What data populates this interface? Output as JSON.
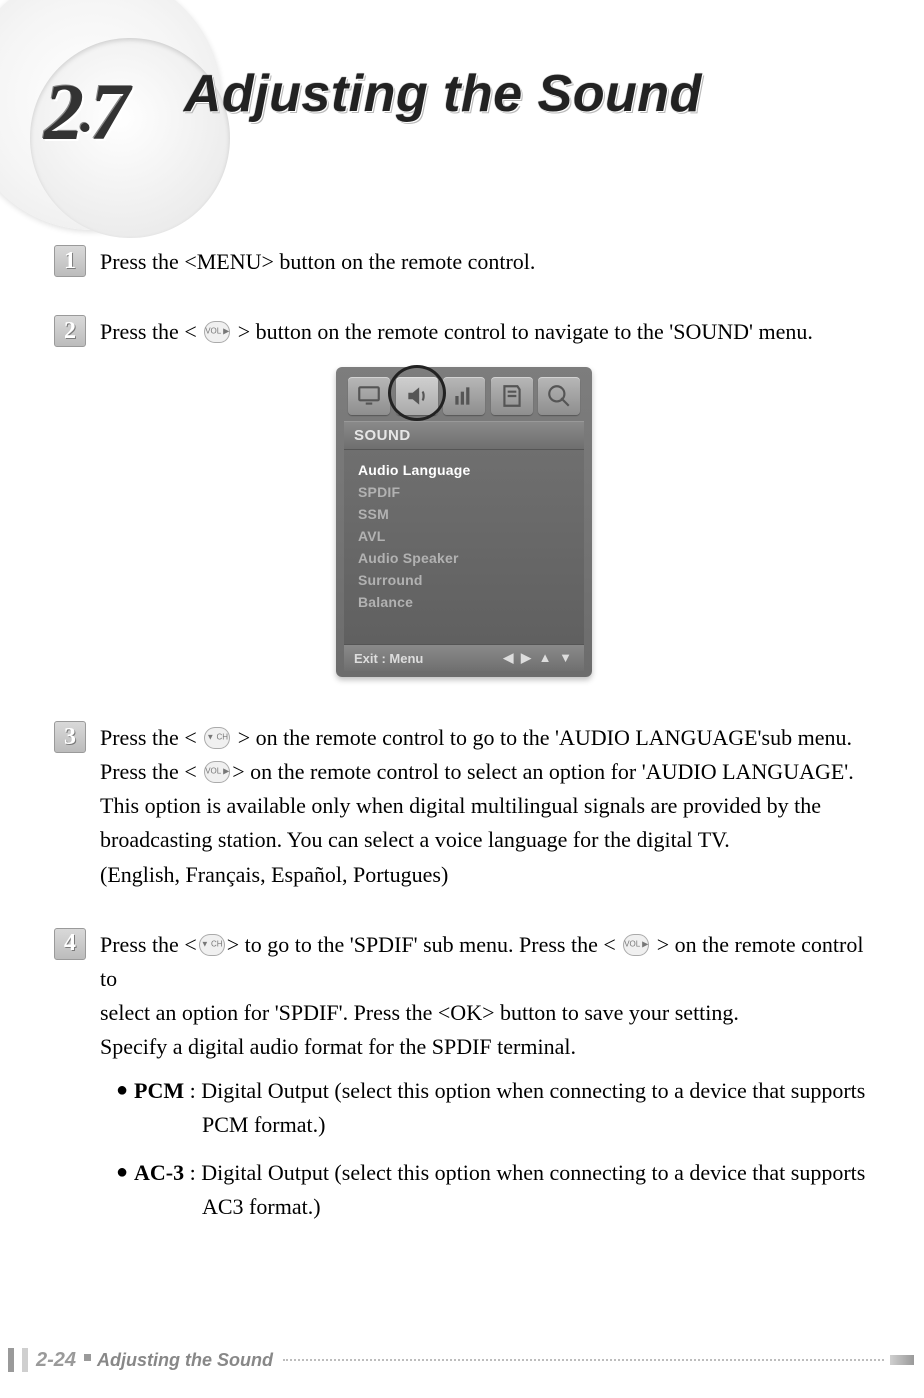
{
  "header": {
    "section_number": "2.7",
    "title": "Adjusting the Sound"
  },
  "steps": {
    "s1": {
      "num": "1",
      "text": "Press the <MENU> button on the remote control."
    },
    "s2": {
      "num": "2",
      "prefix": "Press the < ",
      "suffix": " > button on the remote control to navigate to the 'SOUND' menu."
    },
    "s3": {
      "num": "3",
      "l1a": "Press the < ",
      "l1b": " > on the remote control to go to the 'AUDIO LANGUAGE'sub menu.",
      "l2a": "Press the < ",
      "l2b": "> on the remote control to select an option for 'AUDIO LANGUAGE'.",
      "l3": "This option is available only when digital multilingual signals are provided by the",
      "l4": "broadcasting station. You can select a voice language for the digital TV.",
      "l5": "(English, Français, Español, Portugues)"
    },
    "s4": {
      "num": "4",
      "l1a": "Press the <",
      "l1b": "> to go to the 'SPDIF' sub menu. Press the < ",
      "l1c": " > on the remote control to",
      "l2": "select an option for 'SPDIF'. Press the <OK> button to save your setting.",
      "l3": "Specify a digital audio format for the SPDIF terminal.",
      "bullets": [
        {
          "term": "PCM",
          "rest": " : Digital Output (select this option when connecting to a device that supports",
          "cont": "PCM format.)"
        },
        {
          "term": "AC-3",
          "rest": " : Digital Output (select this option when connecting to a device that supports",
          "cont": "AC3 format.)"
        }
      ]
    }
  },
  "osd": {
    "title": "SOUND",
    "items": [
      "Audio Language",
      "SPDIF",
      "SSM",
      "AVL",
      "Audio Speaker",
      "Surround",
      "Balance"
    ],
    "footer_label": "Exit :   Menu",
    "footer_arrows": "◀ ▶ ▲ ▼"
  },
  "footer": {
    "page": "2-24",
    "title": "Adjusting the Sound"
  }
}
